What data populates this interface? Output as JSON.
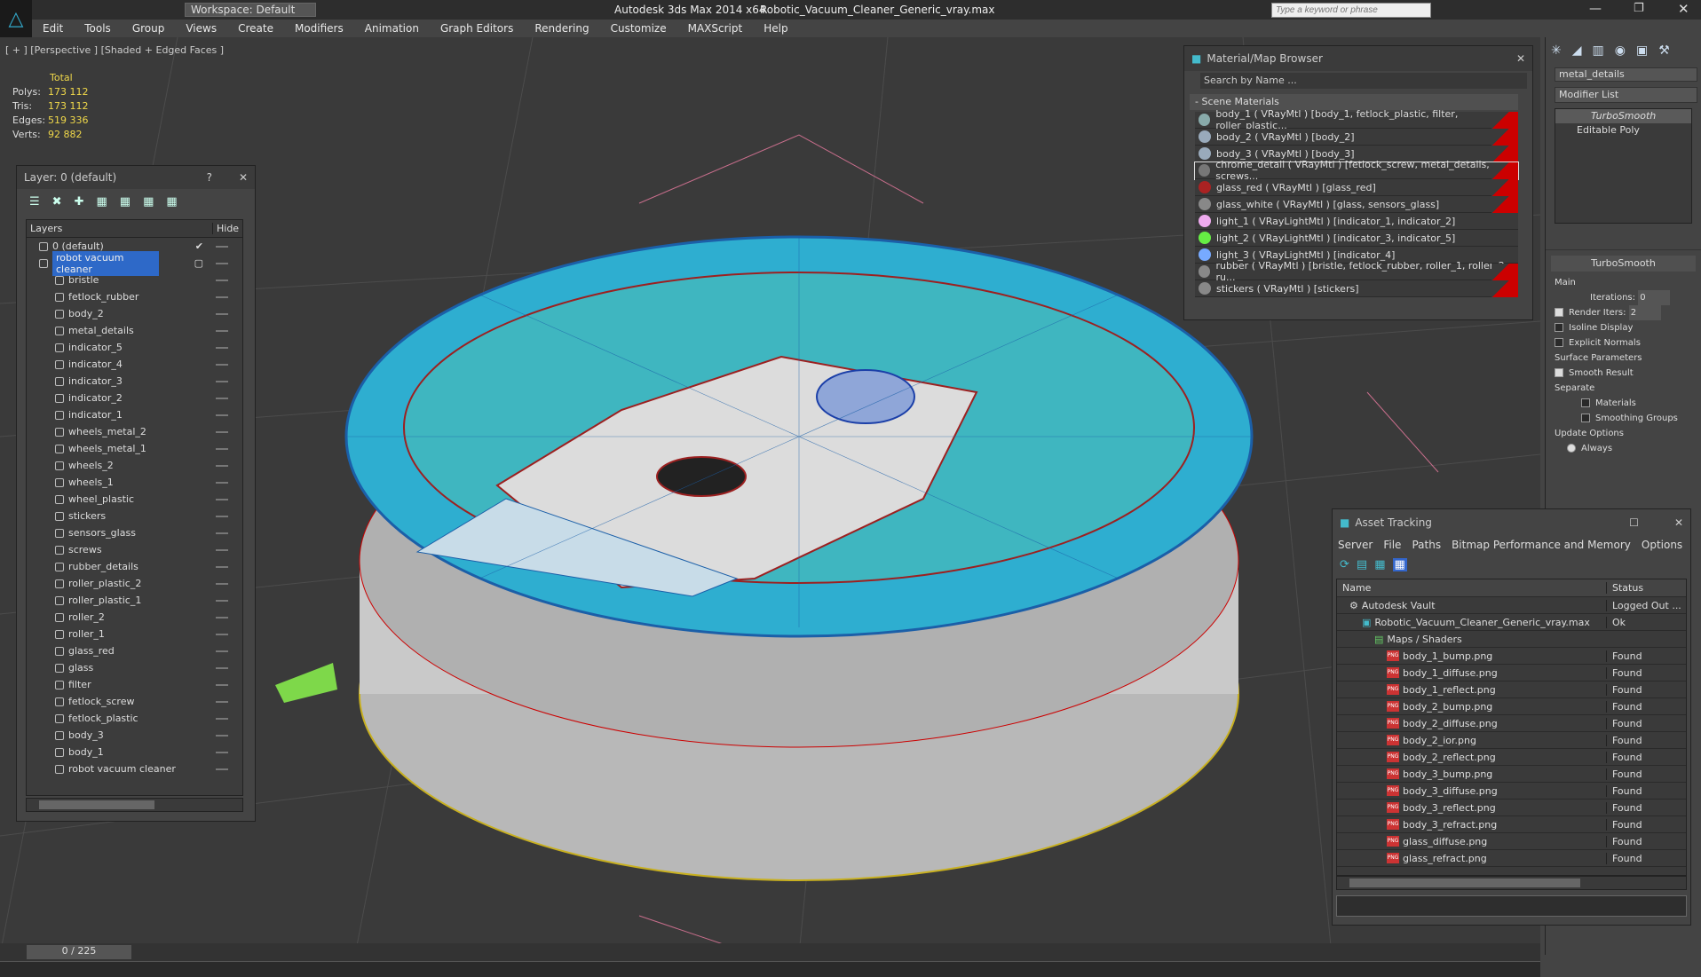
{
  "titlebar": {
    "workspace": "Workspace: Default",
    "app": "Autodesk 3ds Max  2014 x64",
    "file": "Robotic_Vacuum_Cleaner_Generic_vray.max",
    "search_placeholder": "Type a keyword or phrase"
  },
  "menu": [
    "Edit",
    "Tools",
    "Group",
    "Views",
    "Create",
    "Modifiers",
    "Animation",
    "Graph Editors",
    "Rendering",
    "Customize",
    "MAXScript",
    "Help"
  ],
  "viewport": {
    "label": "[ + ] [Perspective ] [Shaded + Edged Faces ]"
  },
  "stats": {
    "total": "Total",
    "rows": [
      {
        "k": "Polys:",
        "v": "173 112"
      },
      {
        "k": "Tris:",
        "v": "173 112"
      },
      {
        "k": "Edges:",
        "v": "519 336"
      },
      {
        "k": "Verts:",
        "v": "92 882"
      }
    ]
  },
  "layer_panel": {
    "title": "Layer: 0 (default)",
    "col_layers": "Layers",
    "col_hide": "Hide",
    "items": [
      "0 (default)",
      "robot vacuum cleaner",
      "bristle",
      "fetlock_rubber",
      "body_2",
      "metal_details",
      "indicator_5",
      "indicator_4",
      "indicator_3",
      "indicator_2",
      "indicator_1",
      "wheels_metal_2",
      "wheels_metal_1",
      "wheels_2",
      "wheels_1",
      "wheel_plastic",
      "stickers",
      "sensors_glass",
      "screws",
      "rubber_details",
      "roller_plastic_2",
      "roller_plastic_1",
      "roller_2",
      "roller_1",
      "glass_red",
      "glass",
      "filter",
      "fetlock_screw",
      "fetlock_plastic",
      "body_3",
      "body_1",
      "robot vacuum cleaner"
    ]
  },
  "material_browser": {
    "title": "Material/Map Browser",
    "search": "Search by Name ...",
    "section": "- Scene Materials",
    "items": [
      {
        "label": "body_1  ( VRayMtl ) [body_1, fetlock_plastic, filter, roller_plastic...",
        "color": "#8aa"
      },
      {
        "label": "body_2  ( VRayMtl ) [body_2]",
        "color": "#9ab"
      },
      {
        "label": "body_3  ( VRayMtl ) [body_3]",
        "color": "#9ab"
      },
      {
        "label": "chrome_detail  ( VRayMtl ) [fetlock_screw, metal_details, screws...",
        "color": "#777"
      },
      {
        "label": "glass_red  ( VRayMtl ) [glass_red]",
        "color": "#a22"
      },
      {
        "label": "glass_white  ( VRayMtl ) [glass, sensors_glass]",
        "color": "#888"
      },
      {
        "label": "light_1  ( VRayLightMtl ) [indicator_1, indicator_2]",
        "color": "#eae"
      },
      {
        "label": "light_2  ( VRayLightMtl ) [indicator_3, indicator_5]",
        "color": "#6e4"
      },
      {
        "label": "light_3  ( VRayLightMtl ) [indicator_4]",
        "color": "#7af"
      },
      {
        "label": "rubber  ( VRayMtl ) [bristle, fetlock_rubber, roller_1, roller_2, ru...",
        "color": "#888"
      },
      {
        "label": "stickers  ( VRayMtl ) [stickers]",
        "color": "#888"
      }
    ]
  },
  "command_panel": {
    "object_name": "metal_details",
    "modifier_list": "Modifier List",
    "stack": [
      "TurboSmooth",
      "Editable Poly"
    ],
    "rollout": "TurboSmooth",
    "main": "Main",
    "iterations_label": "Iterations:",
    "iterations": "0",
    "render_iters_label": "Render Iters:",
    "render_iters": "2",
    "isoline": "Isoline Display",
    "explicit": "Explicit Normals",
    "surface": "Surface Parameters",
    "smooth_result": "Smooth Result",
    "separate": "Separate",
    "materials": "Materials",
    "smoothing": "Smoothing Groups",
    "update": "Update Options",
    "always": "Always"
  },
  "asset_tracking": {
    "title": "Asset Tracking",
    "menu": [
      "Server",
      "File",
      "Paths",
      "Bitmap Performance and Memory",
      "Options"
    ],
    "col_name": "Name",
    "col_status": "Status",
    "rows": [
      {
        "name": "Autodesk Vault",
        "status": "Logged Out ...",
        "indent": 1,
        "type": "vault"
      },
      {
        "name": "Robotic_Vacuum_Cleaner_Generic_vray.max",
        "status": "Ok",
        "indent": 2,
        "type": "max"
      },
      {
        "name": "Maps / Shaders",
        "status": "",
        "indent": 3,
        "type": "folder"
      },
      {
        "name": "body_1_bump.png",
        "status": "Found",
        "indent": 4,
        "type": "png"
      },
      {
        "name": "body_1_diffuse.png",
        "status": "Found",
        "indent": 4,
        "type": "png"
      },
      {
        "name": "body_1_reflect.png",
        "status": "Found",
        "indent": 4,
        "type": "png"
      },
      {
        "name": "body_2_bump.png",
        "status": "Found",
        "indent": 4,
        "type": "png"
      },
      {
        "name": "body_2_diffuse.png",
        "status": "Found",
        "indent": 4,
        "type": "png"
      },
      {
        "name": "body_2_ior.png",
        "status": "Found",
        "indent": 4,
        "type": "png"
      },
      {
        "name": "body_2_reflect.png",
        "status": "Found",
        "indent": 4,
        "type": "png"
      },
      {
        "name": "body_3_bump.png",
        "status": "Found",
        "indent": 4,
        "type": "png"
      },
      {
        "name": "body_3_diffuse.png",
        "status": "Found",
        "indent": 4,
        "type": "png"
      },
      {
        "name": "body_3_reflect.png",
        "status": "Found",
        "indent": 4,
        "type": "png"
      },
      {
        "name": "body_3_refract.png",
        "status": "Found",
        "indent": 4,
        "type": "png"
      },
      {
        "name": "glass_diffuse.png",
        "status": "Found",
        "indent": 4,
        "type": "png"
      },
      {
        "name": "glass_refract.png",
        "status": "Found",
        "indent": 4,
        "type": "png"
      }
    ]
  },
  "timeline": {
    "frame": "0 / 225"
  }
}
